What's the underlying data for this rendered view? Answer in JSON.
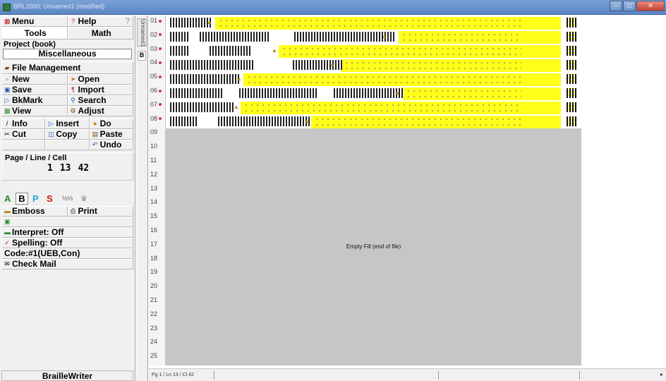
{
  "window": {
    "title": "BRL2000: Unnamed1 (modified)",
    "min_icon": "minimize-icon",
    "max_icon": "maximize-icon",
    "close_icon": "close-icon"
  },
  "panel": {
    "menu_label": "Menu",
    "help_label": "Help",
    "help_q": "?",
    "tab_tools": "Tools",
    "tab_math": "Math",
    "project_label": "Project (book)",
    "project_value": "Miscellaneous",
    "file_mgmt": "File Management",
    "new": "New",
    "open": "Open",
    "save": "Save",
    "import": "Import",
    "bkmark": "BkMark",
    "search": "Search",
    "view": "View",
    "adjust": "Adjust",
    "info": "Info",
    "insert": "Insert",
    "do": "Do",
    "cut": "Cut",
    "copy": "Copy",
    "paste": "Paste",
    "undo": "Undo",
    "pos_label": "Page / Line / Cell",
    "pos_page": "1",
    "pos_line": "13",
    "pos_cell": "42",
    "mode_a": "A",
    "mode_b": "B",
    "mode_p": "P",
    "mode_s": "S",
    "emboss": "Emboss",
    "print": "Print",
    "interpret": "Interpret: Off",
    "spelling": "Spelling: Off",
    "code": "Code:#1(UEB,Con)",
    "checkmail": "Check Mail",
    "braillewriter": "BrailleWriter"
  },
  "doc_tab": {
    "vertical": "Unnamed1",
    "badge": "B"
  },
  "lines": [
    "01",
    "02",
    "03",
    "04",
    "05",
    "06",
    "07",
    "08",
    "09",
    "10",
    "11",
    "12",
    "13",
    "14",
    "15",
    "16",
    "17",
    "18",
    "19",
    "20",
    "21",
    "22",
    "23",
    "24",
    "25"
  ],
  "document": {
    "eof_text": "Empty Fill (end of file)"
  },
  "status": {
    "text": "Pg 1 / Ln 13 / Cl 42"
  },
  "colors": {
    "highlight": "#ffff1a",
    "empty_area": "#c6c6c6"
  }
}
